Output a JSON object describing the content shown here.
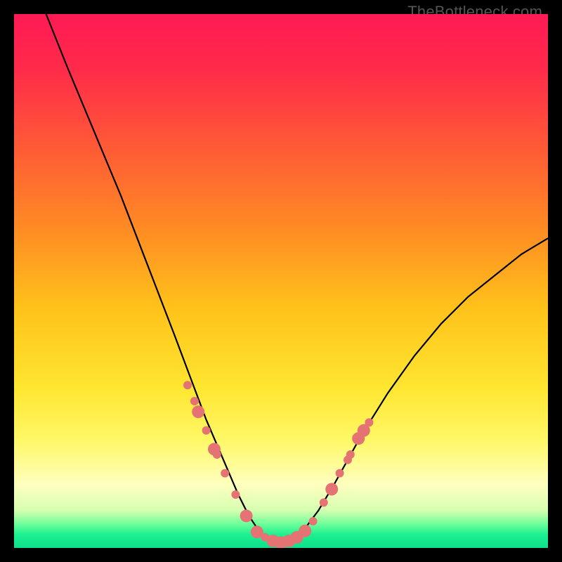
{
  "watermark": "TheBottleneck.com",
  "gradient": {
    "stops": [
      {
        "offset": 0.0,
        "color": "#ff1a55"
      },
      {
        "offset": 0.1,
        "color": "#ff2a4a"
      },
      {
        "offset": 0.25,
        "color": "#ff5a36"
      },
      {
        "offset": 0.4,
        "color": "#ff8a24"
      },
      {
        "offset": 0.55,
        "color": "#ffc21a"
      },
      {
        "offset": 0.7,
        "color": "#ffe630"
      },
      {
        "offset": 0.8,
        "color": "#fff868"
      },
      {
        "offset": 0.88,
        "color": "#ffffbe"
      },
      {
        "offset": 0.93,
        "color": "#d6ffb0"
      },
      {
        "offset": 0.955,
        "color": "#6eff9a"
      },
      {
        "offset": 0.975,
        "color": "#1cf08f"
      },
      {
        "offset": 1.0,
        "color": "#0de08c"
      }
    ]
  },
  "chart_data": {
    "type": "line",
    "title": "",
    "xlabel": "",
    "ylabel": "",
    "xlim": [
      0,
      100
    ],
    "ylim": [
      0,
      100
    ],
    "series": [
      {
        "name": "bottleneck-curve",
        "x": [
          6,
          10,
          15,
          20,
          25,
          30,
          33,
          36,
          39,
          42,
          44,
          46,
          48,
          50,
          52,
          54,
          57,
          60,
          65,
          70,
          75,
          80,
          85,
          90,
          95,
          100
        ],
        "y": [
          100,
          90,
          78,
          66,
          53,
          40,
          32,
          24,
          17,
          10,
          6,
          3,
          1.5,
          1,
          1.5,
          3,
          7,
          12,
          21,
          29,
          36,
          42,
          47,
          51,
          55,
          58
        ]
      }
    ],
    "markers": {
      "name": "highlighted-points",
      "color": "#e57373",
      "radius_small": 6,
      "radius_large": 9,
      "points": [
        {
          "x": 32.5,
          "y": 30.5,
          "r": "small"
        },
        {
          "x": 33.8,
          "y": 27.5,
          "r": "small"
        },
        {
          "x": 34.5,
          "y": 25.5,
          "r": "large"
        },
        {
          "x": 36.0,
          "y": 22.0,
          "r": "small"
        },
        {
          "x": 37.5,
          "y": 18.5,
          "r": "large"
        },
        {
          "x": 38.0,
          "y": 17.5,
          "r": "small"
        },
        {
          "x": 39.5,
          "y": 14.0,
          "r": "small"
        },
        {
          "x": 41.5,
          "y": 10.0,
          "r": "small"
        },
        {
          "x": 43.5,
          "y": 6.0,
          "r": "large"
        },
        {
          "x": 45.5,
          "y": 3.0,
          "r": "large"
        },
        {
          "x": 47.0,
          "y": 2.0,
          "r": "small"
        },
        {
          "x": 48.5,
          "y": 1.3,
          "r": "large"
        },
        {
          "x": 50.0,
          "y": 1.0,
          "r": "large"
        },
        {
          "x": 51.5,
          "y": 1.3,
          "r": "large"
        },
        {
          "x": 53.0,
          "y": 2.0,
          "r": "large"
        },
        {
          "x": 54.5,
          "y": 3.2,
          "r": "large"
        },
        {
          "x": 56.0,
          "y": 5.0,
          "r": "small"
        },
        {
          "x": 58.0,
          "y": 8.5,
          "r": "small"
        },
        {
          "x": 59.5,
          "y": 11.0,
          "r": "large"
        },
        {
          "x": 61.0,
          "y": 14.0,
          "r": "small"
        },
        {
          "x": 62.5,
          "y": 16.5,
          "r": "small"
        },
        {
          "x": 63.0,
          "y": 17.5,
          "r": "small"
        },
        {
          "x": 64.5,
          "y": 20.5,
          "r": "large"
        },
        {
          "x": 65.5,
          "y": 22.0,
          "r": "large"
        },
        {
          "x": 66.5,
          "y": 23.5,
          "r": "small"
        }
      ]
    }
  }
}
